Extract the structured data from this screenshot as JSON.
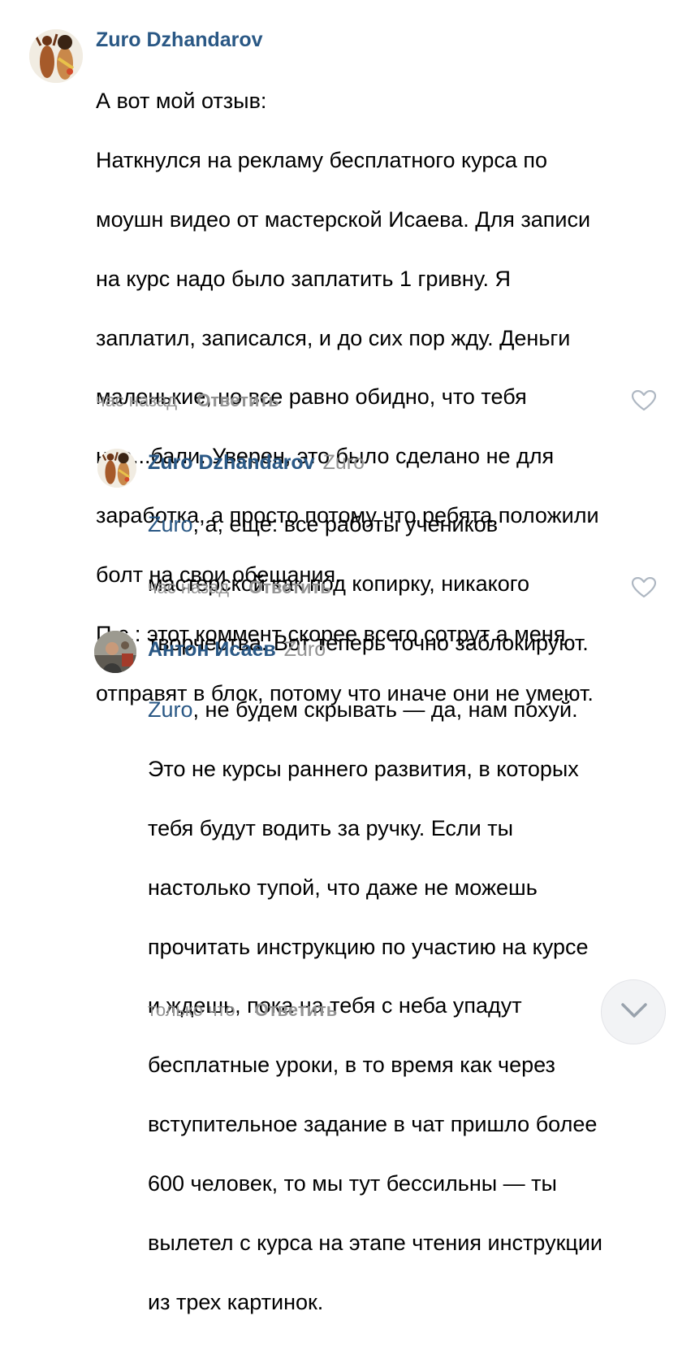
{
  "comments": [
    {
      "author": "Zuro Dzhandarov",
      "reply_to": "",
      "mention": "",
      "text_lines": [
        "А вот мой отзыв:",
        "Наткнулся на рекламу бесплатного курса по",
        "моушн видео от мастерской Исаева. Для записи",
        "на курс надо было заплатить 1 гривну. Я",
        "заплатил, записался, и до сих пор жду. Деньги",
        "маленькие, но все равно обидно, что тебя",
        "нае...бали. Уверен, это было сделано не для",
        "заработка, а просто потому что ребята положили",
        "болт на свои обещания.",
        "П.с.: этот коммент скорее всего сотрут а меня",
        "отправят в блок, потому что иначе они не умеют."
      ],
      "time": "час назад",
      "reply_label": "Ответить",
      "avatar_icon": "avatar-two-dancers"
    },
    {
      "author": "Zuro Dzhandarov",
      "reply_to": "Zuro",
      "mention": "Zuro",
      "text_lines": [
        ", а, ещё: все работы учеников",
        "мастерской как под копирку, никакого",
        "творчества. Вот теперь точно заблокируют."
      ],
      "time": "час назад",
      "reply_label": "Ответить",
      "avatar_icon": "avatar-two-dancers"
    },
    {
      "author": "Антон Исаев",
      "reply_to": "Zuro",
      "mention": "Zuro",
      "text_lines": [
        ", не будем скрывать — да, нам похуй.",
        "Это не курсы раннего развития, в которых",
        "тебя будут водить за ручку. Если ты",
        "настолько тупой, что даже не можешь",
        "прочитать инструкцию по участию на курсе",
        "и ждешь, пока на тебя с неба упадут",
        "бесплатные уроки, в то время как через",
        "вступительное задание в чат пришло более",
        "600 человек, то мы тут бессильны — ты",
        "вылетел с курса на этапе чтения инструкции",
        "из трех картинок."
      ],
      "time": "только что",
      "reply_label": "Ответить",
      "avatar_icon": "avatar-photo"
    }
  ],
  "icons": {
    "like": "heart-outline-icon",
    "scroll": "chevron-down-icon"
  },
  "colors": {
    "link": "#2a5885",
    "meta": "#939393",
    "icon": "#aeb7c2"
  }
}
